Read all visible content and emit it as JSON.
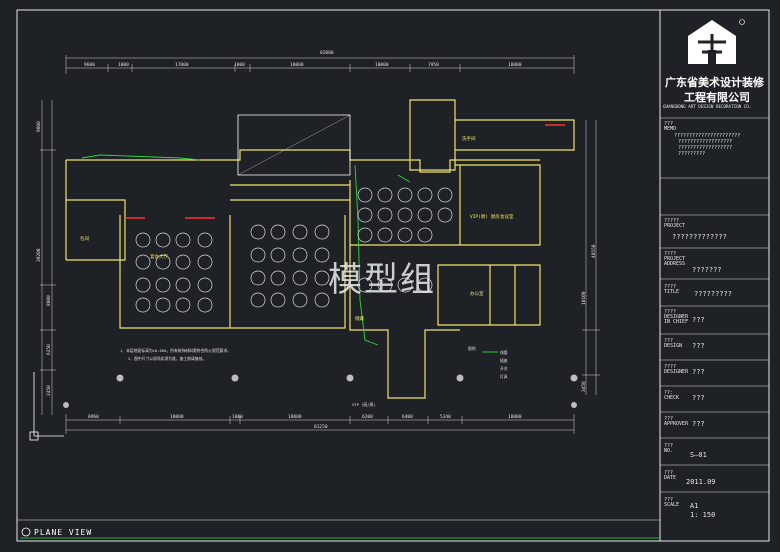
{
  "drawing": {
    "view_title": "PLANE VIEW",
    "watermark": "模型组",
    "dimensions_top_total": "82080",
    "dimensions_top": [
      "9600",
      "1000",
      "17000",
      "1000",
      "18000",
      "10000",
      "7950",
      "18000"
    ],
    "dimensions_bottom_total": "81250",
    "dimensions_bottom": [
      "8960",
      "18000",
      "1000",
      "18000",
      "6200",
      "6400",
      "5340",
      "18000"
    ],
    "dimensions_left": [
      "9800",
      "39200",
      "8800",
      "6250",
      "2450"
    ],
    "dimensions_right": [
      "48550",
      "10100",
      "3450"
    ],
    "room_labels": [
      "宴会大厅",
      "包间",
      "VIP(厨) 厨房",
      "会议室",
      "储藏",
      "办公室",
      "洗手间"
    ],
    "note_line1": "1、本层地面标高为±0.000，所有装饰材料需符合防火规范要求。",
    "note_line2": "2、图中尺寸以现场实测为准，施工前请复核。",
    "legend_title": "图例",
    "legend_items": [
      "线管",
      "插座",
      "开关",
      "灯具"
    ],
    "vip_label": "VIP (厨/厕)"
  },
  "title_block": {
    "company_cn_line1": "广东省美术设计装修",
    "company_cn_line2": "工程有限公司",
    "company_en": "GUANGDONG ART DESIGN DECORATION CO.",
    "memo_label": "???\nMEMO",
    "memo_lines": [
      "??????????????????????",
      "??????????????????",
      "??????????????????",
      "?????????"
    ],
    "project_label": "?????\nPROJECT",
    "project_value": "?????????????",
    "address_label": "????\nPROJECT\nADDRESS",
    "address_value": "???????",
    "title_label": "????\nTITLE",
    "title_value": "?????????",
    "chief_label": "????\nDESIGNER\nIN CHIEF",
    "chief_value": "???",
    "design_label": "???\nDESIGN",
    "design_value": "???",
    "designer_label": "????\nDESIGNER",
    "designer_value": "???",
    "check_label": "??:\nCHECK",
    "check_value": "???",
    "approver_label": "???\nAPPROVER",
    "approver_value": "???",
    "no_label": "???\nNO.",
    "no_value": "S—01",
    "date_label": "???\nDATE",
    "date_value": "2011.09",
    "scale_label": "???\nSCALE",
    "scale_value1": "A1",
    "scale_value2": "1: 150"
  }
}
